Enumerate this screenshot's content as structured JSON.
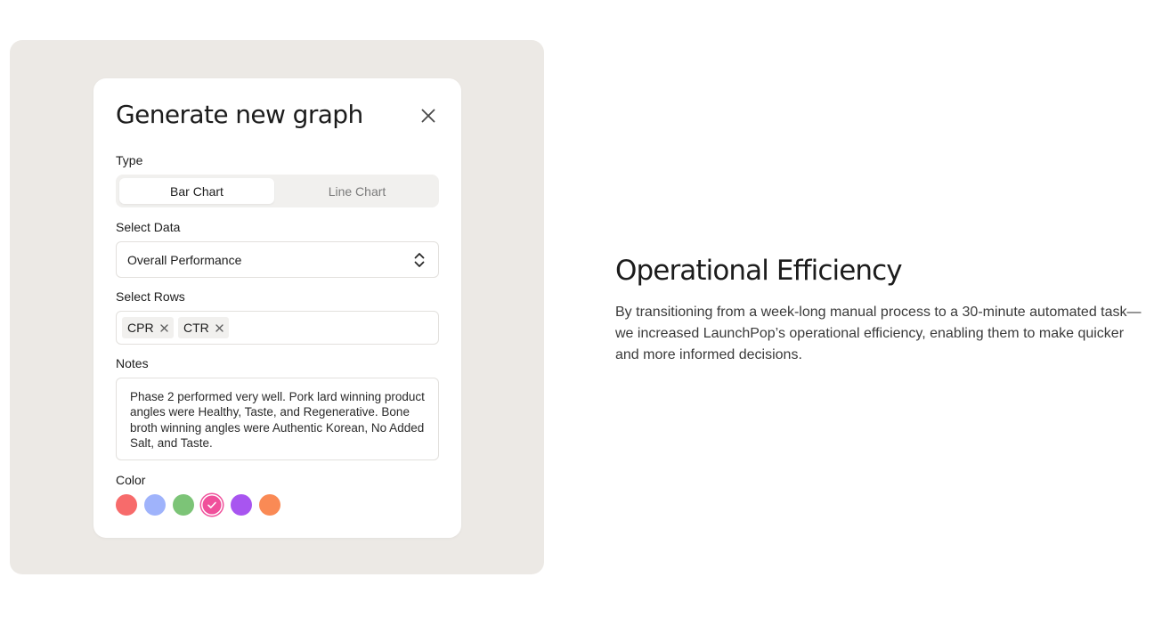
{
  "modal": {
    "title": "Generate new graph",
    "close_icon": "close-icon",
    "type": {
      "label": "Type",
      "options": [
        "Bar Chart",
        "Line Chart"
      ],
      "selected": "Bar Chart"
    },
    "select_data": {
      "label": "Select Data",
      "value": "Overall Performance",
      "icon": "chevron-up-down-icon"
    },
    "select_rows": {
      "label": "Select Rows",
      "chips": [
        "CPR",
        "CTR"
      ],
      "remove_icon": "close-icon"
    },
    "notes": {
      "label": "Notes",
      "value": "Phase 2 performed very well. Pork lard winning product angles were Healthy, Taste, and Regenerative. Bone broth winning angles were Authentic Korean, No Added Salt, and Taste."
    },
    "color": {
      "label": "Color",
      "swatches": [
        "#f76b6b",
        "#9fb3fb",
        "#7cc477",
        "#f0509b",
        "#a855f0",
        "#fa8a55"
      ],
      "selected_index": 3,
      "check_icon": "check-icon"
    }
  },
  "info": {
    "heading": "Operational Efficiency",
    "body": "By transitioning from a week-long manual process to a 30-minute automated task—we increased LaunchPop’s operational efficiency, enabling them to make quicker and more informed decisions."
  },
  "colors": {
    "stage_bg": "#ece9e5",
    "card_bg": "#ffffff",
    "segment_bg": "#f1f0ee",
    "border": "#e2e0dd"
  }
}
